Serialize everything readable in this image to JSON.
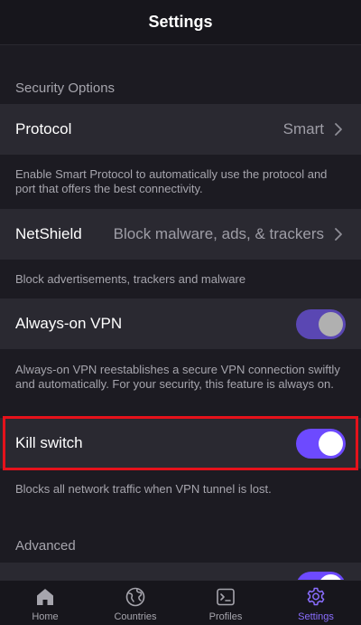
{
  "header": {
    "title": "Settings"
  },
  "sections": {
    "security": {
      "label": "Security Options"
    },
    "advanced": {
      "label": "Advanced"
    }
  },
  "protocol": {
    "label": "Protocol",
    "value": "Smart",
    "description": "Enable Smart Protocol to automatically use the protocol and port that offers the best connectivity."
  },
  "netshield": {
    "label": "NetShield",
    "value": "Block malware, ads, & trackers",
    "description": "Block advertisements, trackers and malware"
  },
  "always_on_vpn": {
    "label": "Always-on VPN",
    "enabled": true,
    "description": "Always-on VPN reestablishes a secure VPN connection swiftly and automatically. For your security, this feature is always on."
  },
  "kill_switch": {
    "label": "Kill switch",
    "enabled": true,
    "description": "Blocks all network traffic when VPN tunnel is lost."
  },
  "tabs": [
    {
      "label": "Home",
      "icon": "home-icon",
      "active": false
    },
    {
      "label": "Countries",
      "icon": "globe-icon",
      "active": false
    },
    {
      "label": "Profiles",
      "icon": "terminal-icon",
      "active": false
    },
    {
      "label": "Settings",
      "icon": "gear-icon",
      "active": true
    }
  ],
  "colors": {
    "accent": "#6d4aff",
    "highlight": "#e5121b",
    "background": "#1c1b22",
    "row": "#2a2931"
  }
}
